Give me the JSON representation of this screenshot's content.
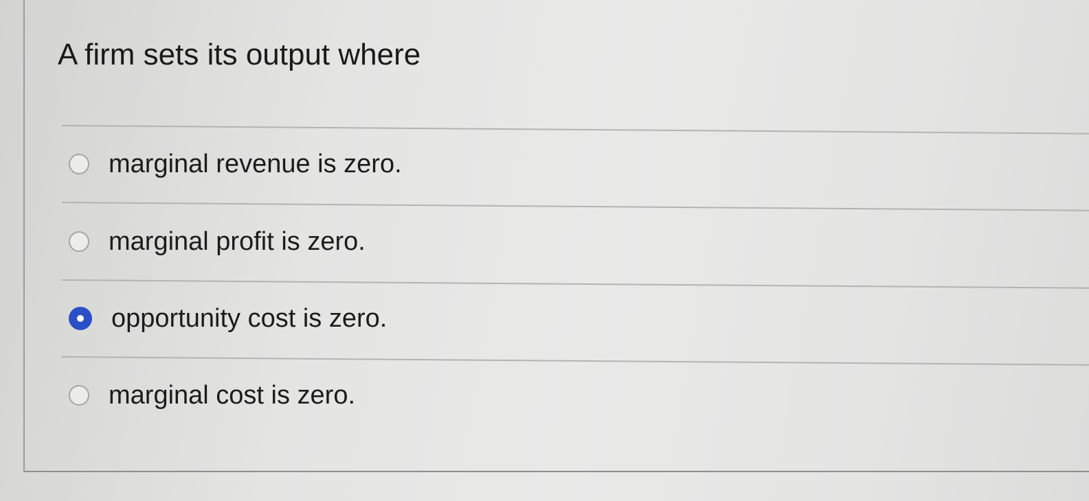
{
  "question": {
    "text": "A firm sets its output where"
  },
  "options": [
    {
      "label": "marginal revenue is zero.",
      "selected": false
    },
    {
      "label": "marginal profit is zero.",
      "selected": false
    },
    {
      "label": "opportunity cost is zero.",
      "selected": true
    },
    {
      "label": "marginal cost is zero.",
      "selected": false
    }
  ],
  "colors": {
    "selected_radio": "#2a4fc6",
    "background": "#e6e6e5"
  }
}
